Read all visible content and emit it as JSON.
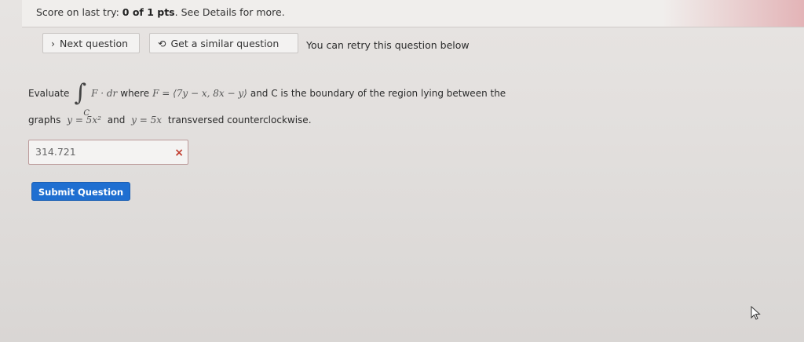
{
  "score": {
    "prefix": "Score on last try:",
    "value": "0 of 1 pts",
    "suffix": ". See Details for more."
  },
  "toolbar": {
    "next_icon": "chevron-right-icon",
    "next_label": "Next question",
    "similar_icon": "refresh-icon",
    "similar_label": "Get a similar question",
    "retry_text": "You can retry this question below"
  },
  "question": {
    "evaluate": "Evaluate",
    "integral_sub": "C",
    "integrand": "F · dr",
    "where": "where",
    "field": "F = ⟨7y − x, 8x − y⟩",
    "boundary": "and C is the boundary of the region lying between the",
    "graphs": "graphs",
    "eq1": "y = 5x²",
    "and": "and",
    "eq2": "y = 5x",
    "transversed": "transversed counterclockwise."
  },
  "answer": {
    "value": "314.721",
    "status_icon": "x-icon",
    "status_color": "#c0392b"
  },
  "submit": {
    "label": "Submit Question",
    "color": "#1f6fd1"
  },
  "cursor": {
    "icon": "mouse-pointer-icon"
  }
}
